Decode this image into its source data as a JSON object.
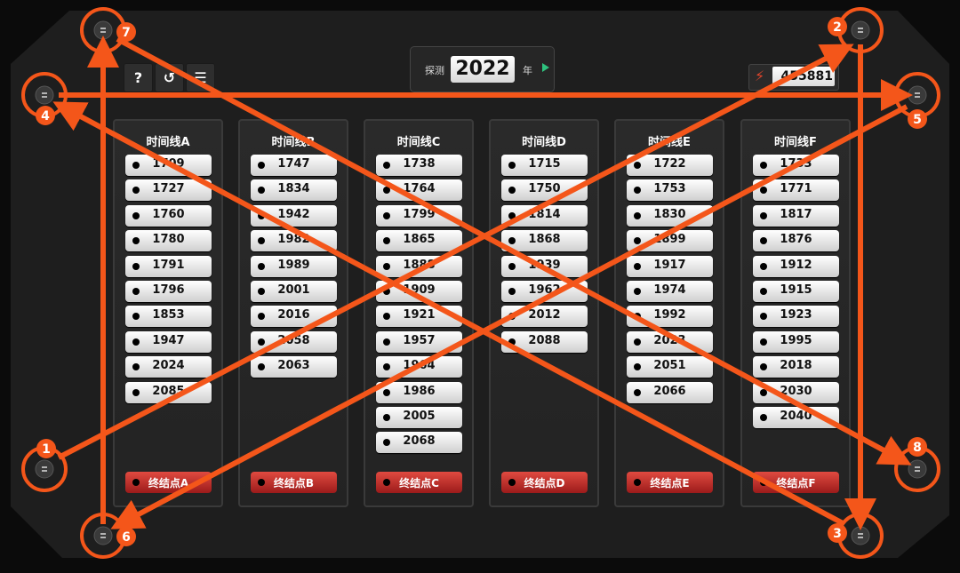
{
  "header": {
    "year_prefix": "探测",
    "year_value": "2022",
    "year_suffix": "年",
    "energy_value": "455881",
    "buttons": [
      {
        "name": "help-button",
        "glyph": "?"
      },
      {
        "name": "history-button",
        "glyph": "↺"
      },
      {
        "name": "log-button",
        "glyph": "☰"
      }
    ]
  },
  "panels": [
    {
      "title": "时间线A",
      "years": [
        "1709",
        "1727",
        "1760",
        "1780",
        "1791",
        "1796",
        "1853",
        "1947",
        "2024",
        "2085"
      ],
      "terminal": "终结点A"
    },
    {
      "title": "时间线B",
      "years": [
        "1747",
        "1834",
        "1942",
        "1982",
        "1989",
        "2001",
        "2016",
        "2058",
        "2063"
      ],
      "terminal": "终结点B"
    },
    {
      "title": "时间线C",
      "years": [
        "1738",
        "1764",
        "1799",
        "1865",
        "1888",
        "1909",
        "1921",
        "1957",
        "1964",
        "1986",
        "2005",
        "2068"
      ],
      "terminal": "终结点C"
    },
    {
      "title": "时间线D",
      "years": [
        "1715",
        "1750",
        "1814",
        "1868",
        "1939",
        "1962",
        "2012",
        "2088"
      ],
      "terminal": "终结点D"
    },
    {
      "title": "时间线E",
      "years": [
        "1722",
        "1753",
        "1830",
        "1899",
        "1917",
        "1974",
        "1992",
        "2023",
        "2051",
        "2066"
      ],
      "terminal": "终结点E"
    },
    {
      "title": "时间线F",
      "years": [
        "1733",
        "1771",
        "1817",
        "1876",
        "1912",
        "1915",
        "1923",
        "1995",
        "2018",
        "2030",
        "2040"
      ],
      "terminal": "终结点F"
    }
  ],
  "annotations": {
    "color": "#f4561a",
    "labels": [
      "1",
      "2",
      "3",
      "4",
      "5",
      "6",
      "7",
      "8"
    ]
  }
}
